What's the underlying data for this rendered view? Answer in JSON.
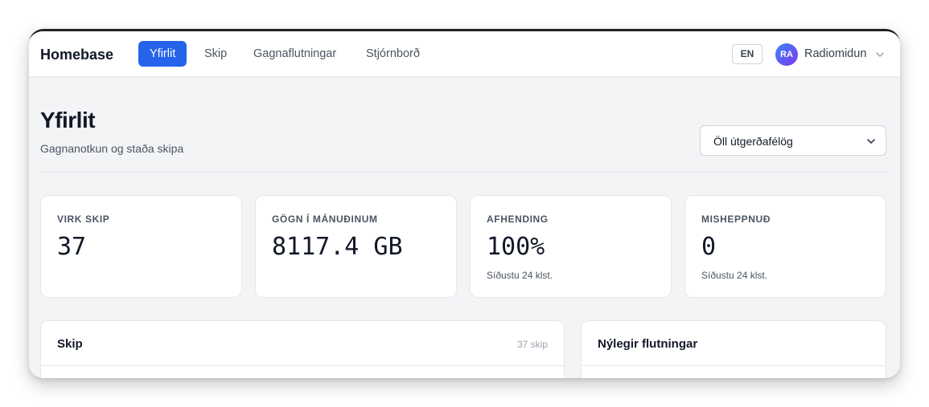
{
  "app": {
    "brand": "Homebase"
  },
  "nav": {
    "items": [
      {
        "label": "Yfirlit",
        "active": true
      },
      {
        "label": "Skip",
        "active": false
      },
      {
        "label": "Gagnaflutningar",
        "active": false
      },
      {
        "label": "Stjórnborð",
        "active": false
      }
    ]
  },
  "header": {
    "lang": "EN",
    "user": {
      "initials": "RA",
      "name": "Radiomidun"
    }
  },
  "page": {
    "title": "Yfirlit",
    "subtitle": "Gagnanotkun og staða skipa",
    "company_select": {
      "value": "Öll útgerðafélög"
    }
  },
  "stats": [
    {
      "label": "VIRK SKIP",
      "value": "37",
      "note": ""
    },
    {
      "label": "GÖGN Í MÁNUÐINUM",
      "value": "8117.4 GB",
      "note": ""
    },
    {
      "label": "AFHENDING",
      "value": "100%",
      "note": "Síðustu 24 klst."
    },
    {
      "label": "MISHEPPNUÐ",
      "value": "0",
      "note": "Síðustu 24 klst."
    }
  ],
  "panels": {
    "ships": {
      "title": "Skip",
      "count": "37 skip"
    },
    "transfers": {
      "title": "Nýlegir flutningar"
    }
  },
  "colors": {
    "accent": "#2563eb",
    "background": "#f3f4f6"
  },
  "icons": {
    "chevron": "chevron-down-icon"
  }
}
